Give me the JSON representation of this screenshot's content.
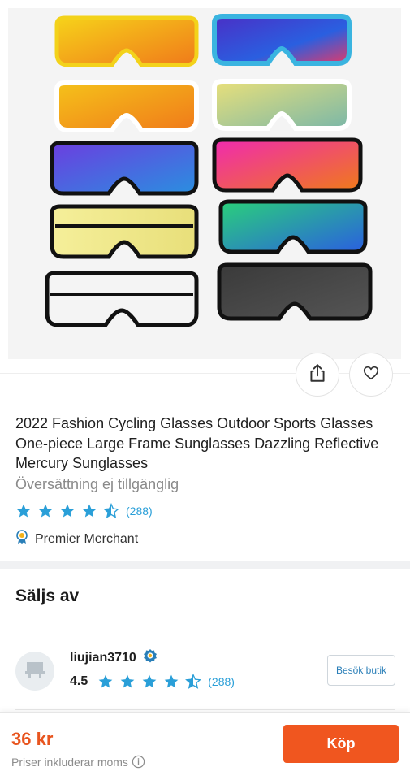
{
  "product": {
    "title": "2022 Fashion Cycling Glasses Outdoor Sports Glasses One-piece Large Frame Sunglasses Dazzling Reflective Mercury Sunglasses",
    "translation_note": "Översättning ej tillgänglig",
    "rating_stars": 4.5,
    "rating_count": "(288)",
    "premier_label": "Premier Merchant",
    "image_icon": "sunglasses-product-image"
  },
  "seller": {
    "section_title": "Säljs av",
    "name": "liujian3710",
    "score": "4.5",
    "rating_stars": 4.5,
    "rating_count": "(288)",
    "visit_label": "Besök butik"
  },
  "purchase": {
    "price": "36 kr",
    "price_note": "Priser inkluderar moms",
    "buy_label": "Köp"
  },
  "icons": {
    "share": "share-icon",
    "favorite": "heart-icon",
    "premier": "ribbon-badge-icon",
    "store": "store-icon",
    "info": "info-icon"
  },
  "colors": {
    "accent_orange": "#f0561f",
    "star_blue": "#2a9fd8",
    "link_blue": "#2a7fb8"
  }
}
